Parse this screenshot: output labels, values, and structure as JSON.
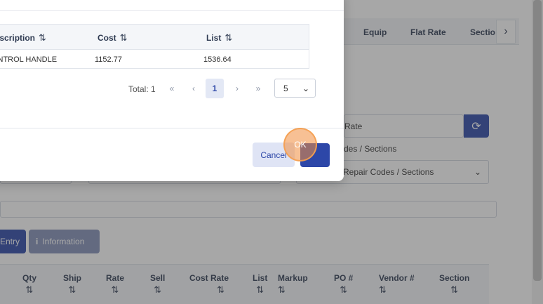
{
  "background": {
    "tabs": [
      "Equip",
      "Flat Rate",
      "Sectio"
    ],
    "rate_input_value": "Rate",
    "repair_codes_label": "des / Sections",
    "repair_codes_select": "Repair Codes / Sections",
    "entry_button": "Entry",
    "information_button": "Information",
    "grid_columns": [
      "Qty",
      "Ship",
      "Rate",
      "Sell",
      "Cost Rate",
      "List",
      "Markup",
      "PO #",
      "Vendor #",
      "Section"
    ]
  },
  "modal": {
    "table": {
      "headers": [
        "Description",
        "Cost",
        "List"
      ],
      "rows": [
        {
          "description": "CONTROL HANDLE",
          "cost": "1152.77",
          "list": "1536.64"
        }
      ]
    },
    "pager": {
      "total_label": "Total: 1",
      "first": "«",
      "prev": "‹",
      "page": "1",
      "next": "›",
      "last": "»",
      "page_size": "5"
    },
    "cancel_label": "Cancel",
    "ok_label": "OK"
  },
  "icons": {
    "sort": "⇅",
    "chevron_right": "›",
    "chevron_down": "⌄",
    "refresh": "⟳",
    "info": "i"
  },
  "colors": {
    "primary": "#2d47a8",
    "highlight": "#f08c3c"
  }
}
